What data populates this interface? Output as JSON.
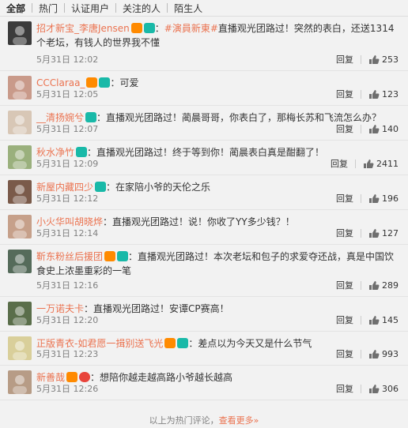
{
  "tabs": [
    {
      "label": "全部",
      "active": true
    },
    {
      "label": "热门"
    },
    {
      "label": "认证用户"
    },
    {
      "label": "关注的人"
    },
    {
      "label": "陌生人"
    }
  ],
  "comments": [
    {
      "user": "招才新宝_李唐Jensen",
      "topic": "#演員新東#",
      "text": "直播观光团路过！突然的表白，还送1314个老坛，有钱人的世界我不懂",
      "time": "5月31日  12:02",
      "likes": "253"
    },
    {
      "user": "CCClaraa_",
      "topic": "",
      "text": "可爱",
      "time": "5月31日  12:05",
      "likes": "123"
    },
    {
      "user": "__清扬婉兮",
      "topic": "",
      "text": "直播观光团路过！蔺晨哥哥，你表白了，那梅长苏和飞流怎么办？",
      "time": "5月31日  12:07",
      "likes": "140"
    },
    {
      "user": "秋水净竹",
      "topic": "",
      "text": "直播观光团路过！终于等到你！蔺晨表白真是酣翻了！",
      "time": "5月31日  12:09",
      "likes": "2411"
    },
    {
      "user": "新屋内藏四少",
      "topic": "",
      "text": "在家陪小爷的天伦之乐",
      "time": "5月31日  12:12",
      "likes": "196"
    },
    {
      "user": "小火华叫胡晓烨",
      "topic": "",
      "text": "直播观光团路过！说！你收了YY多少钱？！",
      "time": "5月31日  12:14",
      "likes": "127"
    },
    {
      "user": "靳东粉丝后援团",
      "topic": "",
      "text": "直播观光团路过！本次老坛和包子的求爱夺还战，真是中国饮食史上浓墨重彩的一笔",
      "time": "5月31日  12:16",
      "likes": "289"
    },
    {
      "user": "一万诺夫卡",
      "topic": "",
      "text": "直播观光团路过！安谭CP赛高！",
      "time": "5月31日  12:20",
      "likes": "145"
    },
    {
      "user": "正版青衣-如君愿一揖别送飞光",
      "topic": "",
      "text": "差点以为今天又是什么节气",
      "time": "5月31日  12:23",
      "likes": "993"
    },
    {
      "user": "新善哉",
      "topic": "",
      "text": "想陪你越走越高路小爷越长越高",
      "time": "5月31日  12:26",
      "likes": "306"
    }
  ],
  "reply_label": "回复",
  "footer": {
    "text": "以上为热门评论，",
    "link": "查看更多»"
  }
}
